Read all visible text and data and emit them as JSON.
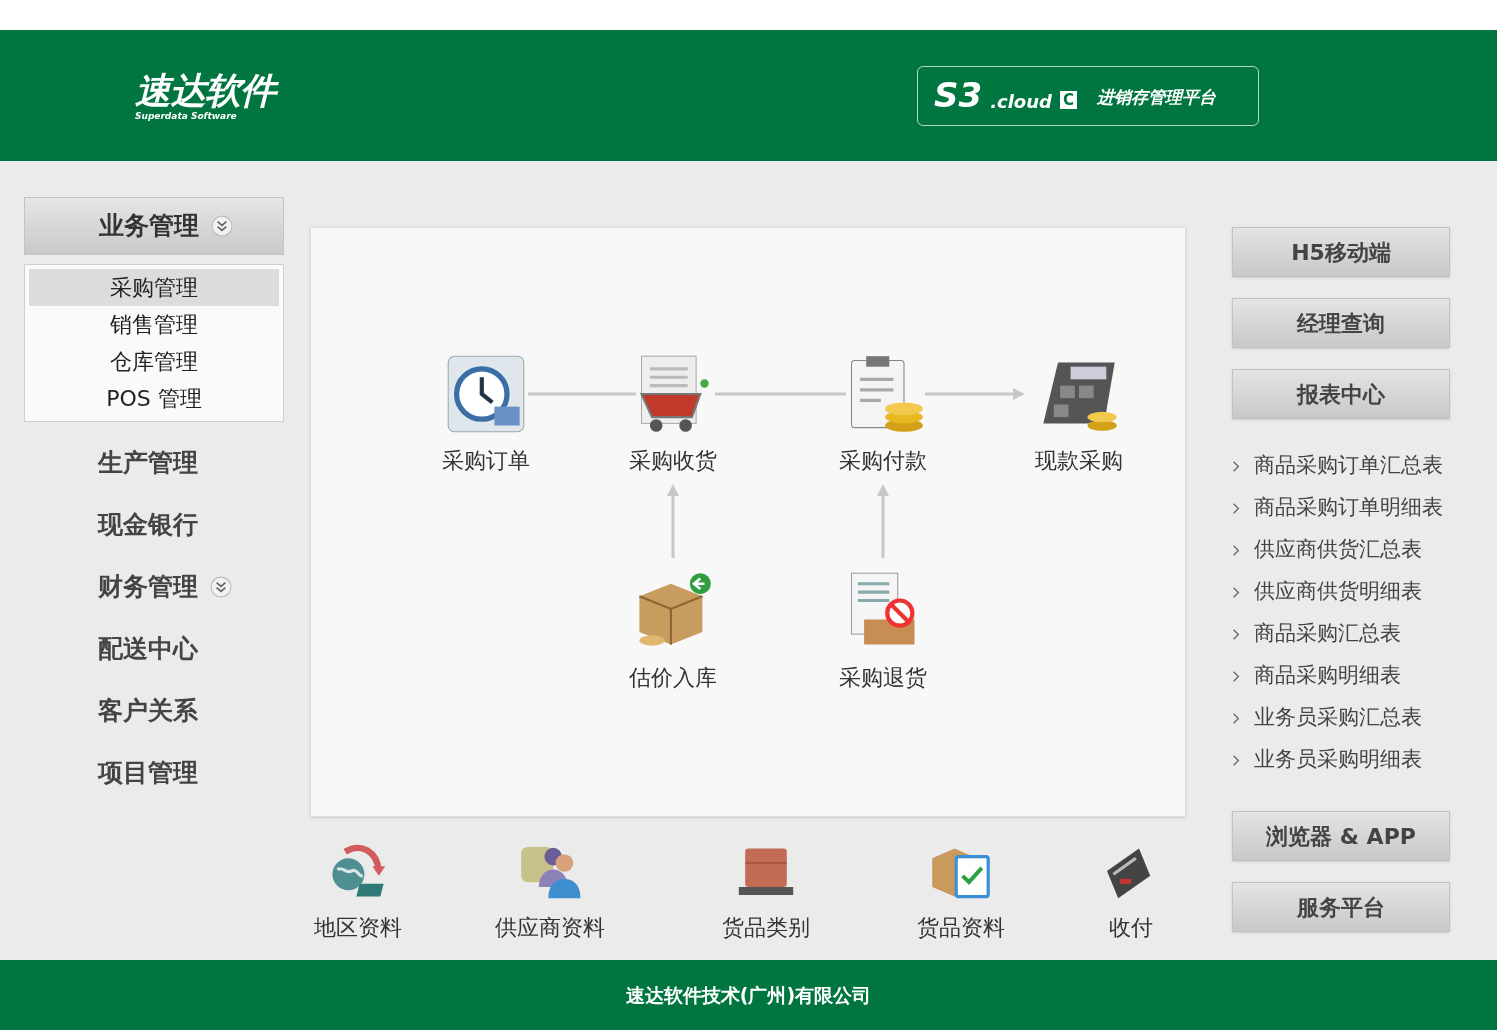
{
  "header": {
    "logo": "速达软件",
    "logo_subtitle": "Superdata Software",
    "product": {
      "name": "S3",
      "suffix": ".cloud",
      "edition": "C",
      "subtitle": "进销存管理平台"
    }
  },
  "sidebar": {
    "items": [
      {
        "label": "业务管理",
        "expanded": true,
        "children": [
          {
            "label": "采购管理",
            "selected": true
          },
          {
            "label": "销售管理",
            "selected": false
          },
          {
            "label": "仓库管理",
            "selected": false
          },
          {
            "label": "POS 管理",
            "selected": false
          }
        ]
      },
      {
        "label": "生产管理"
      },
      {
        "label": "现金银行"
      },
      {
        "label": "财务管理",
        "expanded": false
      },
      {
        "label": "配送中心"
      },
      {
        "label": "客户关系"
      },
      {
        "label": "项目管理"
      }
    ]
  },
  "flow": {
    "nodes": [
      {
        "label": "采购订单",
        "kind": "clock"
      },
      {
        "label": "采购收货",
        "kind": "cart"
      },
      {
        "label": "采购付款",
        "kind": "payment"
      },
      {
        "label": "现款采购",
        "kind": "calculator"
      },
      {
        "label": "估价入库",
        "kind": "boxes"
      },
      {
        "label": "采购退货",
        "kind": "return"
      }
    ]
  },
  "shortcuts": [
    {
      "label": "地区资料",
      "kind": "globe"
    },
    {
      "label": "供应商资料",
      "kind": "people"
    },
    {
      "label": "货品类别",
      "kind": "crate"
    },
    {
      "label": "货品资料",
      "kind": "checklist"
    },
    {
      "label": "收付",
      "kind": "pos"
    }
  ],
  "right_panel": {
    "top_buttons": [
      "H5移动端",
      "经理查询",
      "报表中心"
    ],
    "reports": [
      "商品采购订单汇总表",
      "商品采购订单明细表",
      "供应商供货汇总表",
      "供应商供货明细表",
      "商品采购汇总表",
      "商品采购明细表",
      "业务员采购汇总表",
      "业务员采购明细表"
    ],
    "bottom_buttons": [
      "浏览器 & APP",
      "服务平台"
    ]
  },
  "footer": "速达软件技术(广州)有限公司"
}
